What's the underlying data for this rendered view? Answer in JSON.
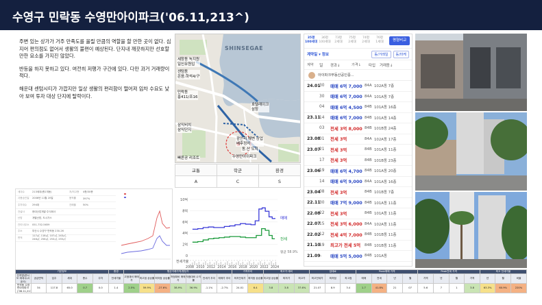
{
  "title": "수영구 민락동 수영만아이파크('06.11,213^)",
  "notes": [
    "주변 있는 상가가 거주 만족도를 올릴 만큼의 역할을 할 만한 곳이 없다. 심지어 편의점도 없어서 생활의 불편이 예상된다. 단지내 깨끗하지만 선호할 만한 요소를 가지진 않았다.",
    "반등을 하지 못하고 있다. 여전히 저평가 구간에 있다. 다만 과거 거래량이 적다.",
    "해운대 센텀시티가 가깝지만 일상 생활의 편리함이 떨어져 임차 수요도 낮아 보여 투자 대상 단지에 탈락이다."
  ],
  "map": {
    "sea_label": "SHINSEGAE",
    "labels": [
      "세창동 녹지원\n일신유원입",
      "센텀동\n온음.하석4/구",
      "민락동\n흥411/조16",
      "삼익비치\n삼익단지",
      "호텔레이크\n삼창",
      "광안리 해변 상업\n배후정치",
      "동.산 도지",
      "수영만아이파크",
      "빠른공 리조트"
    ],
    "badges": [
      "7.2",
      "7.3",
      "7.8",
      "7.5",
      "7.6",
      "6",
      "6.5",
      "7.8",
      "7.3",
      "6.1",
      "5.0",
      "3.0",
      "1.8"
    ]
  },
  "scores": {
    "headers": [
      "교통",
      "학군",
      "환경"
    ],
    "values": [
      "A",
      "C",
      "S"
    ]
  },
  "transactions": {
    "tabs": [
      {
        "label": "35평\n100세대",
        "active": true
      },
      {
        "label": "36평\n100세대",
        "active": false
      },
      {
        "label": "73평\n2세대",
        "active": false
      },
      {
        "label": "75평\n2세대",
        "active": false
      },
      {
        "label": "74평\n2세대",
        "active": false
      },
      {
        "label": "76평\n1세대",
        "active": false
      }
    ],
    "compare_button": "평형비교",
    "filter_label": "계약일 ▾ 정보",
    "filter_pills": [
      "동/거래일",
      "동/마케"
    ],
    "columns": [
      "계약",
      "일",
      "경과↓",
      "가격↓",
      "타입",
      "거래동↓"
    ],
    "agent": "아이파크부동산공인중...",
    "rows": [
      {
        "ym": "24.01",
        "day": "30",
        "type": "sale",
        "price": "매매 6억 7,000",
        "area": "84A",
        "floor": "102A동 7층"
      },
      {
        "ym": "",
        "day": "30",
        "type": "sale",
        "price": "매매 6억 7,000",
        "area": "84A",
        "floor": "101A동 7층"
      },
      {
        "ym": "",
        "day": "04",
        "type": "sale",
        "price": "매매 6억 4,500",
        "area": "84B",
        "floor": "101A동 16층"
      },
      {
        "ym": "23.11",
        "day": "14",
        "type": "sale",
        "price": "매매 6억 7,000",
        "area": "84B",
        "floor": "101A동 14층"
      },
      {
        "ym": "",
        "day": "03",
        "type": "rent",
        "price": "전세 3억 8,000",
        "area": "84B",
        "floor": "101B동 24층"
      },
      {
        "ym": "23.08",
        "day": "01",
        "type": "rent",
        "price": "전세 3억",
        "area": "84A",
        "floor": "102A동 17층"
      },
      {
        "ym": "23.07",
        "day": "21",
        "type": "rent",
        "price": "전세 3억",
        "area": "84B",
        "floor": "101A동 11층"
      },
      {
        "ym": "",
        "day": "17",
        "type": "rent",
        "price": "전세 3억",
        "area": "84B",
        "floor": "101B동 23층"
      },
      {
        "ym": "23.06",
        "day": "19",
        "type": "sale",
        "price": "매매 6억 4,700",
        "area": "84B",
        "floor": "101A동 20층"
      },
      {
        "ym": "",
        "day": "14",
        "type": "sale",
        "price": "매매 6억 9,000",
        "area": "84A",
        "floor": "101A동 16층"
      },
      {
        "ym": "23.04",
        "day": "08",
        "type": "rent",
        "price": "전세 3억",
        "area": "84B",
        "floor": "101B동 7층"
      },
      {
        "ym": "22.11",
        "day": "30",
        "type": "sale",
        "price": "매매 7억 9,000",
        "area": "84B",
        "floor": "101A동 11층"
      },
      {
        "ym": "22.08",
        "day": "22",
        "type": "rent",
        "price": "전세 3억",
        "area": "84B",
        "floor": "101A동 11층"
      },
      {
        "ym": "22.07",
        "day": "15",
        "type": "rent",
        "price": "전세 3억 6,000",
        "area": "84A",
        "floor": "102A동 11층"
      },
      {
        "ym": "22.02",
        "day": "12",
        "type": "rent",
        "price": "전세 4억 7,000",
        "area": "84B",
        "floor": "101B동 11층"
      },
      {
        "ym": "21.10",
        "day": "19",
        "type": "rent",
        "price": "최고가 전세 5억",
        "area": "84B",
        "floor": "101B동 11층"
      },
      {
        "ym": "21.09",
        "day": "..",
        "type": "sale",
        "price": "매매 5억 5,000",
        "area": "84B",
        "floor": "101A동"
      }
    ]
  },
  "info_card": {
    "rows": [
      {
        "k": "세대수",
        "v": "213세대(총2개동)",
        "k2": "저/최고층",
        "v2": "4층/30층"
      },
      {
        "k": "사용승인일",
        "v": "2006년 11월 20일",
        "k2": "용적률",
        "v2": "397%"
      },
      {
        "k": "주차대수",
        "v": "294대",
        "k2": "건폐율",
        "v2": "50%"
      },
      {
        "k": "건설사",
        "v": "현대산업개발·주식회사",
        "k2": "",
        "v2": ""
      },
      {
        "k": "난방",
        "v": "개별난방, 도시가스",
        "k2": "",
        "v2": ""
      },
      {
        "k": "관리사무소",
        "v": "051-752-5659",
        "k2": "",
        "v2": ""
      },
      {
        "k": "주소",
        "v": "부산시 수영구 민락동 230-26",
        "k2": "",
        "v2": ""
      },
      {
        "k": "면적",
        "v": "117㎡, 118㎡, 107㎡, 243㎡, 246㎡, 258㎡, 253㎡, 255㎡",
        "k2": "",
        "v2": ""
      }
    ]
  },
  "price_chart": {
    "type": "line",
    "x_ticks": [
      "2008",
      "2010",
      "2012",
      "2014",
      "2016",
      "2018",
      "2020",
      "2022",
      "2024"
    ],
    "y_ticks": [
      "10억",
      "8억",
      "6억",
      "4억",
      "2억",
      "0"
    ],
    "series": [
      {
        "name": "매매",
        "color": "#3a3ad8",
        "points": [
          [
            2008.5,
            4.7
          ],
          [
            2009.5,
            4.8
          ],
          [
            2010.5,
            5.0
          ],
          [
            2011.5,
            5.1
          ],
          [
            2012.5,
            5.0
          ],
          [
            2013.5,
            5.0
          ],
          [
            2014.5,
            5.2
          ],
          [
            2015.5,
            5.3
          ],
          [
            2016.5,
            5.5
          ],
          [
            2017.5,
            5.7
          ],
          [
            2018.5,
            5.6
          ],
          [
            2019.5,
            5.5
          ],
          [
            2020.3,
            6.2
          ],
          [
            2021.0,
            8.3
          ],
          [
            2021.6,
            8.5
          ],
          [
            2022.2,
            7.9
          ],
          [
            2022.9,
            6.9
          ],
          [
            2023.5,
            6.6
          ],
          [
            2024.0,
            6.7
          ]
        ]
      },
      {
        "name": "전세",
        "color": "#1a9a3a",
        "points": [
          [
            2008.5,
            2.4
          ],
          [
            2009.5,
            2.5
          ],
          [
            2010.5,
            2.8
          ],
          [
            2011.5,
            3.0
          ],
          [
            2012.5,
            3.1
          ],
          [
            2013.5,
            3.2
          ],
          [
            2014.5,
            3.3
          ],
          [
            2015.5,
            3.4
          ],
          [
            2016.5,
            3.4
          ],
          [
            2017.5,
            3.3
          ],
          [
            2018.5,
            3.2
          ],
          [
            2019.5,
            3.2
          ],
          [
            2020.5,
            3.6
          ],
          [
            2021.5,
            4.8
          ],
          [
            2022.2,
            4.5
          ],
          [
            2022.9,
            3.6
          ],
          [
            2023.5,
            3.0
          ],
          [
            2024.0,
            3.0
          ]
        ]
      }
    ],
    "ratio_label": "전세가율",
    "ratio_value": "평균\n58.9%",
    "volume_label": "거래량"
  },
  "bottom_table": {
    "group_headers": [
      "기본정보",
      "환경",
      "평균거래가격/평당가",
      "가격추이",
      "최고가 대비",
      "임대료",
      "Peak매매 가격",
      "Peak전세 가격",
      "최고 전세가율"
    ],
    "sub_headers": [
      "단지명(준시도·세대수/시공사)",
      "공급면적",
      "입주",
      "세대",
      "층수",
      "주차",
      "전세가율",
      "고점대비 매매가",
      "최고점 상승률",
      "최저점 상승률",
      "저점대비 매매가",
      "저점대비 수익률",
      "전세가 추이",
      "매매가 추이",
      "최저전세가",
      "최저점 상승률",
      "최고점 상승률",
      "최저가",
      "최고가",
      "최고전세가",
      "최저점",
      "최고점",
      "매매",
      "전세",
      "년",
      "월",
      "가격",
      "년",
      "월",
      "가격",
      "년",
      "월",
      "비율"
    ],
    "row": [
      "민락동 수영만아이파크('06.11,213^)",
      "34",
      "117.8",
      "65.0",
      "0.7",
      "0.0",
      "1.4",
      "2.5%",
      "59.9%",
      "-27.6%",
      "38.9%",
      "36.9%",
      "-1.1%",
      "-2.7%",
      "24.01",
      "6.4",
      "3.8",
      "3.8",
      "37.6%",
      "21.07",
      "8.9",
      "3.4",
      "1.7",
      "41.8%",
      "21",
      "07",
      "5.6",
      "7",
      "1",
      "3.8",
      "63.3%",
      "60.9%",
      "220%"
    ]
  }
}
